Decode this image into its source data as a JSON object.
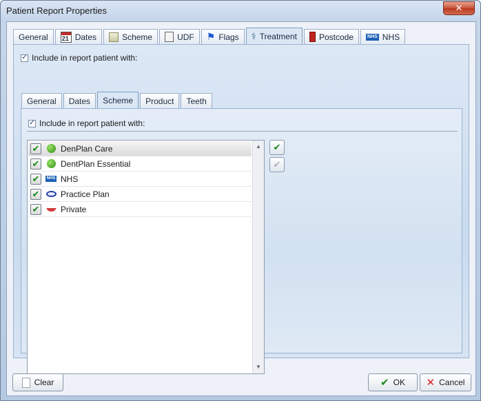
{
  "window": {
    "title": "Patient Report Properties",
    "close_glyph": "✕"
  },
  "outer_tabs": [
    {
      "label": "General",
      "icon": "none"
    },
    {
      "label": "Dates",
      "icon": "calendar-icon"
    },
    {
      "label": "Scheme",
      "icon": "scheme-icon"
    },
    {
      "label": "UDF",
      "icon": "udf-icon"
    },
    {
      "label": "Flags",
      "icon": "flag-icon"
    },
    {
      "label": "Treatment",
      "icon": "treatment-icon",
      "active": true
    },
    {
      "label": "Postcode",
      "icon": "postcode-icon"
    },
    {
      "label": "NHS",
      "icon": "nhs-icon"
    }
  ],
  "calendar_day": "21",
  "nhs_badge": "NHS",
  "outer_include_label": "Include in report patient with:",
  "inner_tabs": [
    {
      "label": "General"
    },
    {
      "label": "Dates"
    },
    {
      "label": "Scheme",
      "active": true
    },
    {
      "label": "Product"
    },
    {
      "label": "Teeth"
    }
  ],
  "inner_include_label": "Include in report patient with:",
  "scheme_list": [
    {
      "label": "DenPlan Care",
      "icon": "apple-icon",
      "checked": true,
      "selected": true
    },
    {
      "label": "DentPlan Essential",
      "icon": "apple-icon",
      "checked": true
    },
    {
      "label": "NHS",
      "icon": "nhs-icon",
      "checked": true
    },
    {
      "label": "Practice Plan",
      "icon": "practice-plan-icon",
      "checked": true
    },
    {
      "label": "Private",
      "icon": "private-smile-icon",
      "checked": true
    }
  ],
  "buttons": {
    "clear": "Clear",
    "ok": "OK",
    "cancel": "Cancel"
  },
  "colors": {
    "check_green": "#1c8a1c",
    "cancel_red": "#d0201a",
    "title_bar": "#c3d4ea",
    "close_red": "#c75138"
  }
}
